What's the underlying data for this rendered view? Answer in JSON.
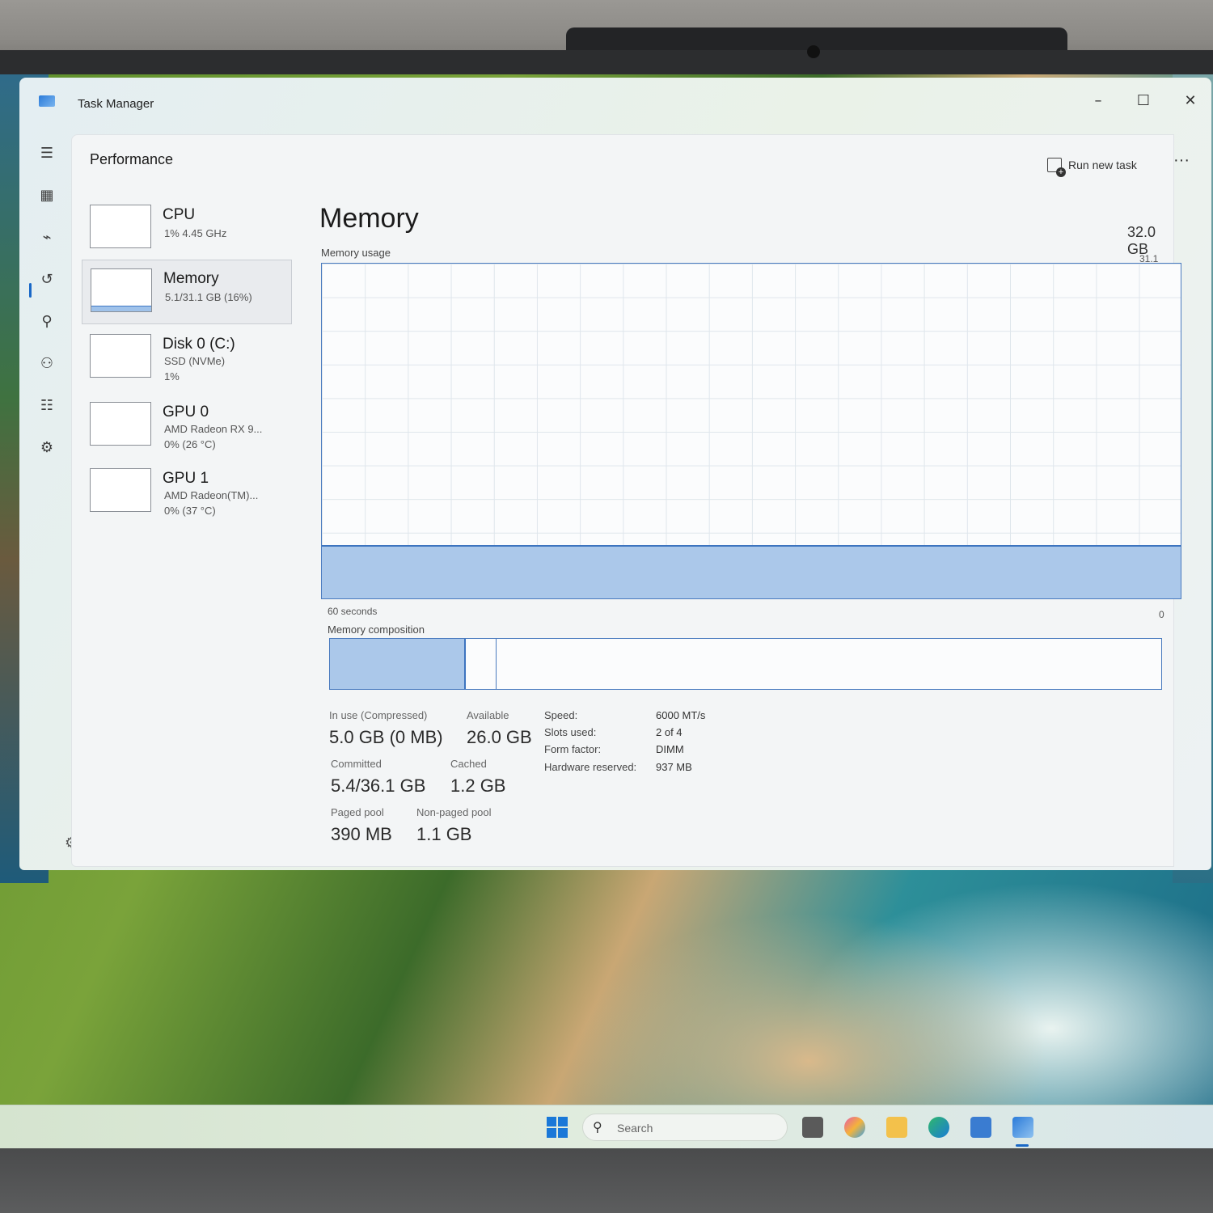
{
  "window": {
    "title": "Task Manager",
    "minimize_icon": "minimize-icon",
    "maximize_icon": "maximize-icon",
    "close_icon": "close-icon"
  },
  "nav": {
    "items": [
      {
        "name": "hamburger-menu-icon",
        "glyph": "☰"
      },
      {
        "name": "processes-icon",
        "glyph": "▦"
      },
      {
        "name": "performance-icon",
        "glyph": "⌁"
      },
      {
        "name": "app-history-icon",
        "glyph": "↺"
      },
      {
        "name": "startup-apps-icon",
        "glyph": "⚲"
      },
      {
        "name": "users-icon",
        "glyph": "⚇"
      },
      {
        "name": "details-icon",
        "glyph": "☷"
      },
      {
        "name": "services-icon",
        "glyph": "⚙"
      }
    ],
    "settings_icon": "settings-icon"
  },
  "header": {
    "page_title": "Performance",
    "run_new_task": "Run new task",
    "more": "···"
  },
  "resources": [
    {
      "name": "CPU",
      "line1": "1% 4.45 GHz",
      "line2": ""
    },
    {
      "name": "Memory",
      "line1": "5.1/31.1 GB (16%)",
      "line2": ""
    },
    {
      "name": "Disk 0 (C:)",
      "line1": "SSD (NVMe)",
      "line2": "1%"
    },
    {
      "name": "GPU 0",
      "line1": "AMD Radeon RX 9...",
      "line2": "0% (26 °C)"
    },
    {
      "name": "GPU 1",
      "line1": "AMD Radeon(TM)...",
      "line2": "0% (37 °C)"
    }
  ],
  "memory": {
    "title": "Memory",
    "total": "32.0 GB",
    "usage_label": "Memory usage",
    "max_label": "31.1 GB",
    "time_left": "60 seconds",
    "time_right": "0",
    "composition_label": "Memory composition",
    "usage_fraction": 0.16,
    "composition_in_use_fraction": 0.163,
    "composition_modified_fraction": 0.2
  },
  "stats": {
    "in_use_label": "In use (Compressed)",
    "in_use_value": "5.0 GB (0 MB)",
    "available_label": "Available",
    "available_value": "26.0 GB",
    "committed_label": "Committed",
    "committed_value": "5.4/36.1 GB",
    "cached_label": "Cached",
    "cached_value": "1.2 GB",
    "paged_label": "Paged pool",
    "paged_value": "390 MB",
    "nonpaged_label": "Non-paged pool",
    "nonpaged_value": "1.1 GB"
  },
  "specs": {
    "speed_label": "Speed:",
    "speed_value": "6000 MT/s",
    "slots_label": "Slots used:",
    "slots_value": "2 of 4",
    "form_label": "Form factor:",
    "form_value": "DIMM",
    "reserved_label": "Hardware reserved:",
    "reserved_value": "937 MB"
  },
  "taskbar": {
    "search_placeholder": "Search",
    "apps": [
      "task-view-icon",
      "copilot-icon",
      "file-explorer-icon",
      "edge-icon",
      "store-icon",
      "task-manager-icon"
    ]
  },
  "colors": {
    "accent": "#1a68c7",
    "graph_fill": "#abc8ea",
    "graph_line": "#3d74bf"
  }
}
